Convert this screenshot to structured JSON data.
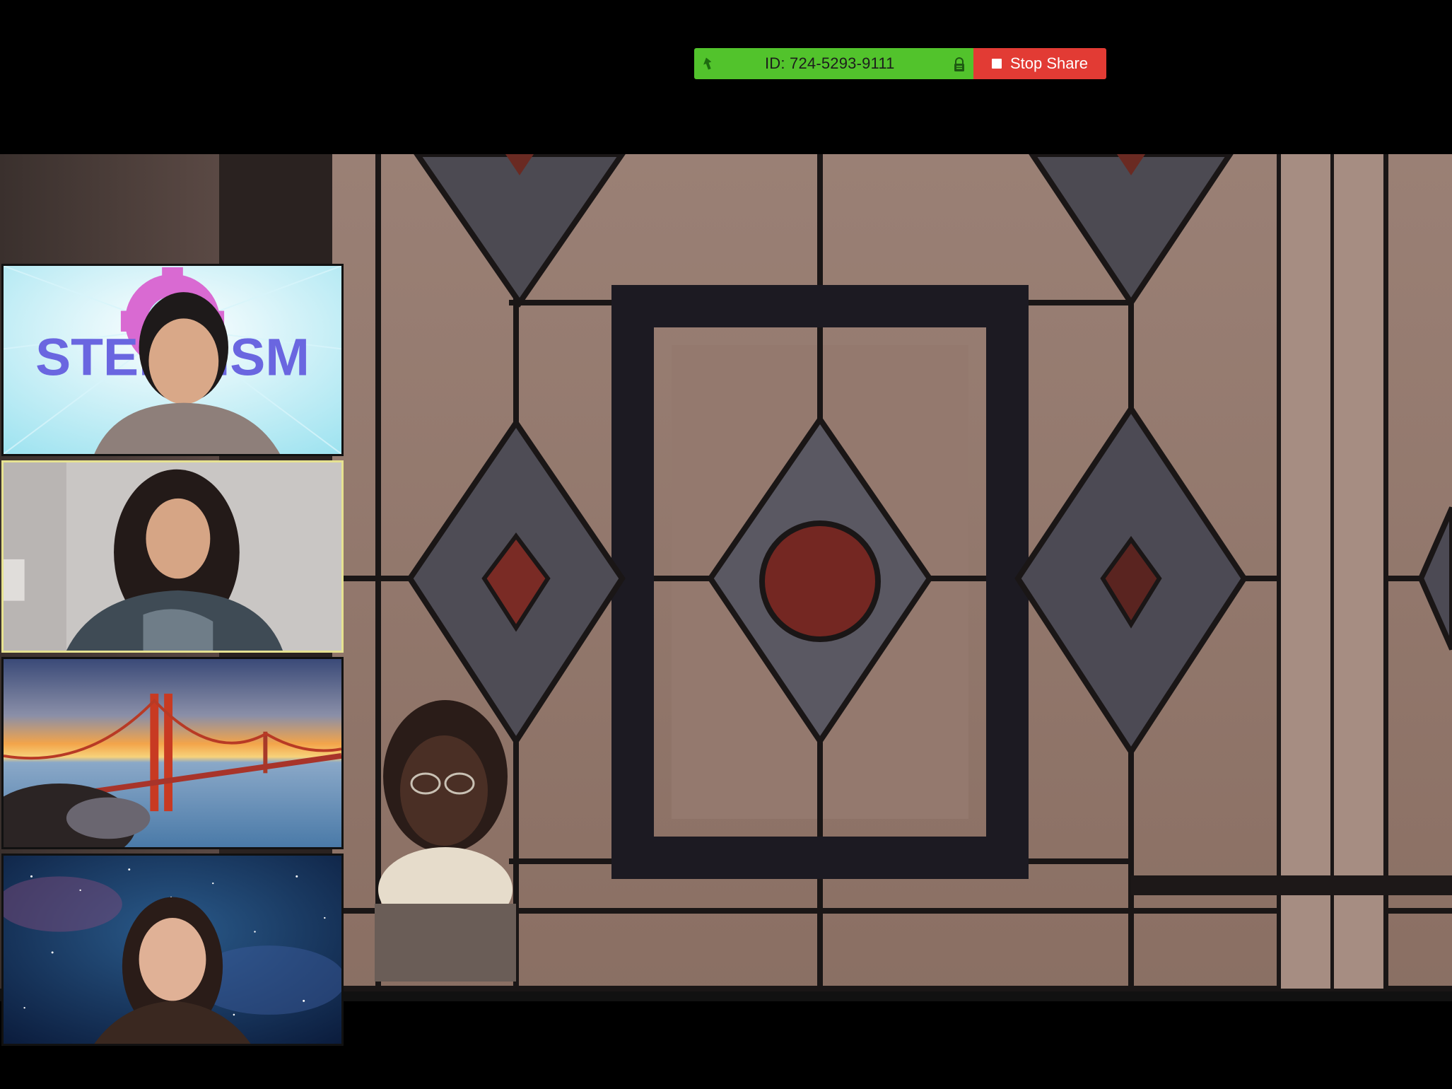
{
  "share_toolbar": {
    "meeting_id_label": "ID: 724-5293-9111",
    "stop_share_label": "Stop Share",
    "colors": {
      "info_bg": "#52c32c",
      "stop_bg": "#e23b34"
    },
    "icons": [
      "share-arrow-icon",
      "lock-icon",
      "stop-square-icon"
    ]
  },
  "gallery": {
    "tiles": [
      {
        "background_text": "STEMTISM",
        "active": false
      },
      {
        "background_text": "",
        "active": true
      },
      {
        "background_text": "",
        "active": false
      },
      {
        "background_text": "",
        "active": false
      }
    ],
    "active_speaker_border_color": "#e6e291"
  },
  "main_share": {
    "content": "stained-glass-video"
  }
}
